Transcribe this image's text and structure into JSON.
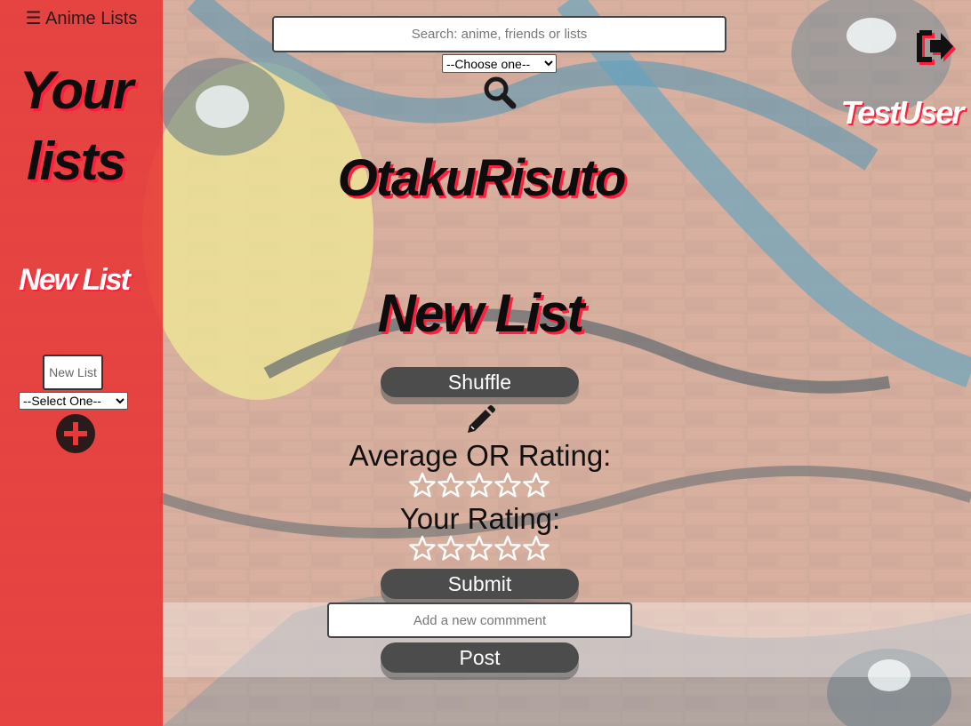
{
  "sidebar": {
    "toggle_label": "☰ Anime Lists",
    "title": "Your lists",
    "new_list_heading": "New List",
    "new_list_placeholder": "New List",
    "type_select_value": "--Select One--",
    "add_button_icon": "plus-circle-icon"
  },
  "header": {
    "search_placeholder": "Search: anime, friends or lists",
    "search_type_value": "--Choose one--",
    "search_icon": "search-icon",
    "logout_icon": "logout-icon",
    "username": "TestUser",
    "site_title": "OtakuRisuto"
  },
  "list": {
    "title": "New List",
    "shuffle_label": "Shuffle",
    "edit_icon": "pencil-icon",
    "average_rating_label": "Average OR Rating:",
    "average_rating_stars": 0,
    "your_rating_label": "Your Rating:",
    "your_rating_stars": 0,
    "max_stars": 5,
    "submit_label": "Submit",
    "comment_placeholder": "Add a new commment",
    "post_label": "Post"
  },
  "colors": {
    "sidebar": "#e73434",
    "accent_shadow": "#ff1e3c",
    "button": "#4c4c4c"
  }
}
